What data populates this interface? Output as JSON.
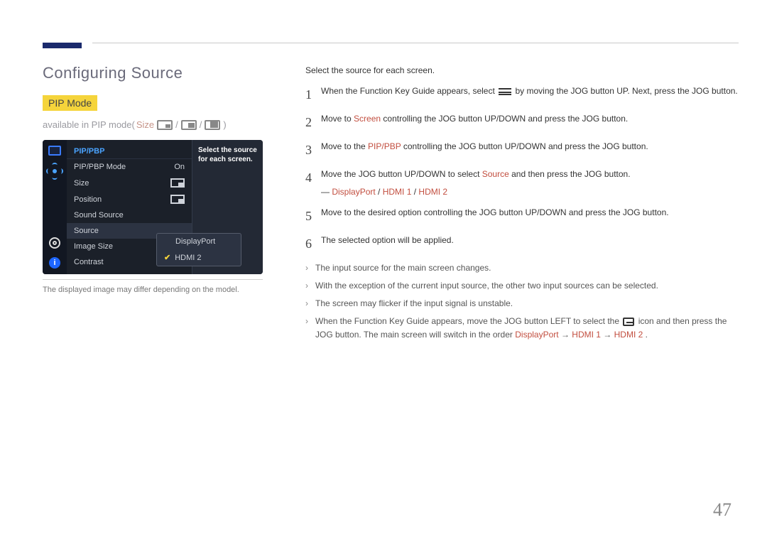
{
  "header": {
    "title": "Configuring Source"
  },
  "pip": {
    "badge": "PIP Mode",
    "avail_prefix": "available in PIP mode(",
    "avail_size_label": "Size",
    "avail_suffix": ")"
  },
  "osd": {
    "title": "PIP/PBP",
    "items": [
      {
        "label": "PIP/PBP Mode",
        "value": "On"
      },
      {
        "label": "Size",
        "value": ""
      },
      {
        "label": "Position",
        "value": ""
      },
      {
        "label": "Sound Source",
        "value": ""
      },
      {
        "label": "Source",
        "value": ""
      },
      {
        "label": "Image Size",
        "value": ""
      },
      {
        "label": "Contrast",
        "value": ""
      }
    ],
    "help_line1": "Select the source",
    "help_line2": "for each screen.",
    "popup": {
      "opt1": "DisplayPort",
      "opt2": "HDMI 2"
    },
    "disclaimer": "The displayed image may differ depending on the model."
  },
  "right": {
    "intro": "Select the source for each screen.",
    "steps": [
      {
        "n": "1",
        "pre": "When the Function Key Guide appears, select ",
        "icon": "menu",
        "post": " by moving the JOG button UP. Next, press the JOG button."
      },
      {
        "n": "2",
        "pre": "Move to ",
        "k": "Screen",
        "post": " controlling the JOG button UP/DOWN and press the JOG button."
      },
      {
        "n": "3",
        "pre": "Move to the ",
        "k": "PIP/PBP",
        "post": " controlling the JOG button UP/DOWN and press the JOG button."
      },
      {
        "n": "4",
        "pre": "Move the JOG button UP/DOWN to select ",
        "k": "Source",
        "post": " and then press the JOG button."
      },
      {
        "n": "5",
        "pre": "Move to the desired option controlling the JOG button UP/DOWN and press the JOG button.",
        "k": "",
        "post": ""
      },
      {
        "n": "6",
        "pre": "The selected option will be applied.",
        "k": "",
        "post": ""
      }
    ],
    "opts_lead": "― ",
    "opts": {
      "a": "DisplayPort",
      "sep": " / ",
      "b": "HDMI 1",
      "c": "HDMI 2"
    },
    "bullets": [
      "The input source for the main screen changes.",
      "With the exception of the current input source, the other two input sources can be selected.",
      "The screen may flicker if the input signal is unstable."
    ],
    "bullet4_pre": "When the Function Key Guide appears, move the JOG button LEFT to select the ",
    "bullet4_post": " icon and then press the JOG button. The main screen will switch in the order ",
    "seq": {
      "a": "DisplayPort",
      "arrow": " → ",
      "b": "HDMI 1",
      "c": "HDMI 2",
      "dot": "."
    }
  },
  "page_number": "47"
}
